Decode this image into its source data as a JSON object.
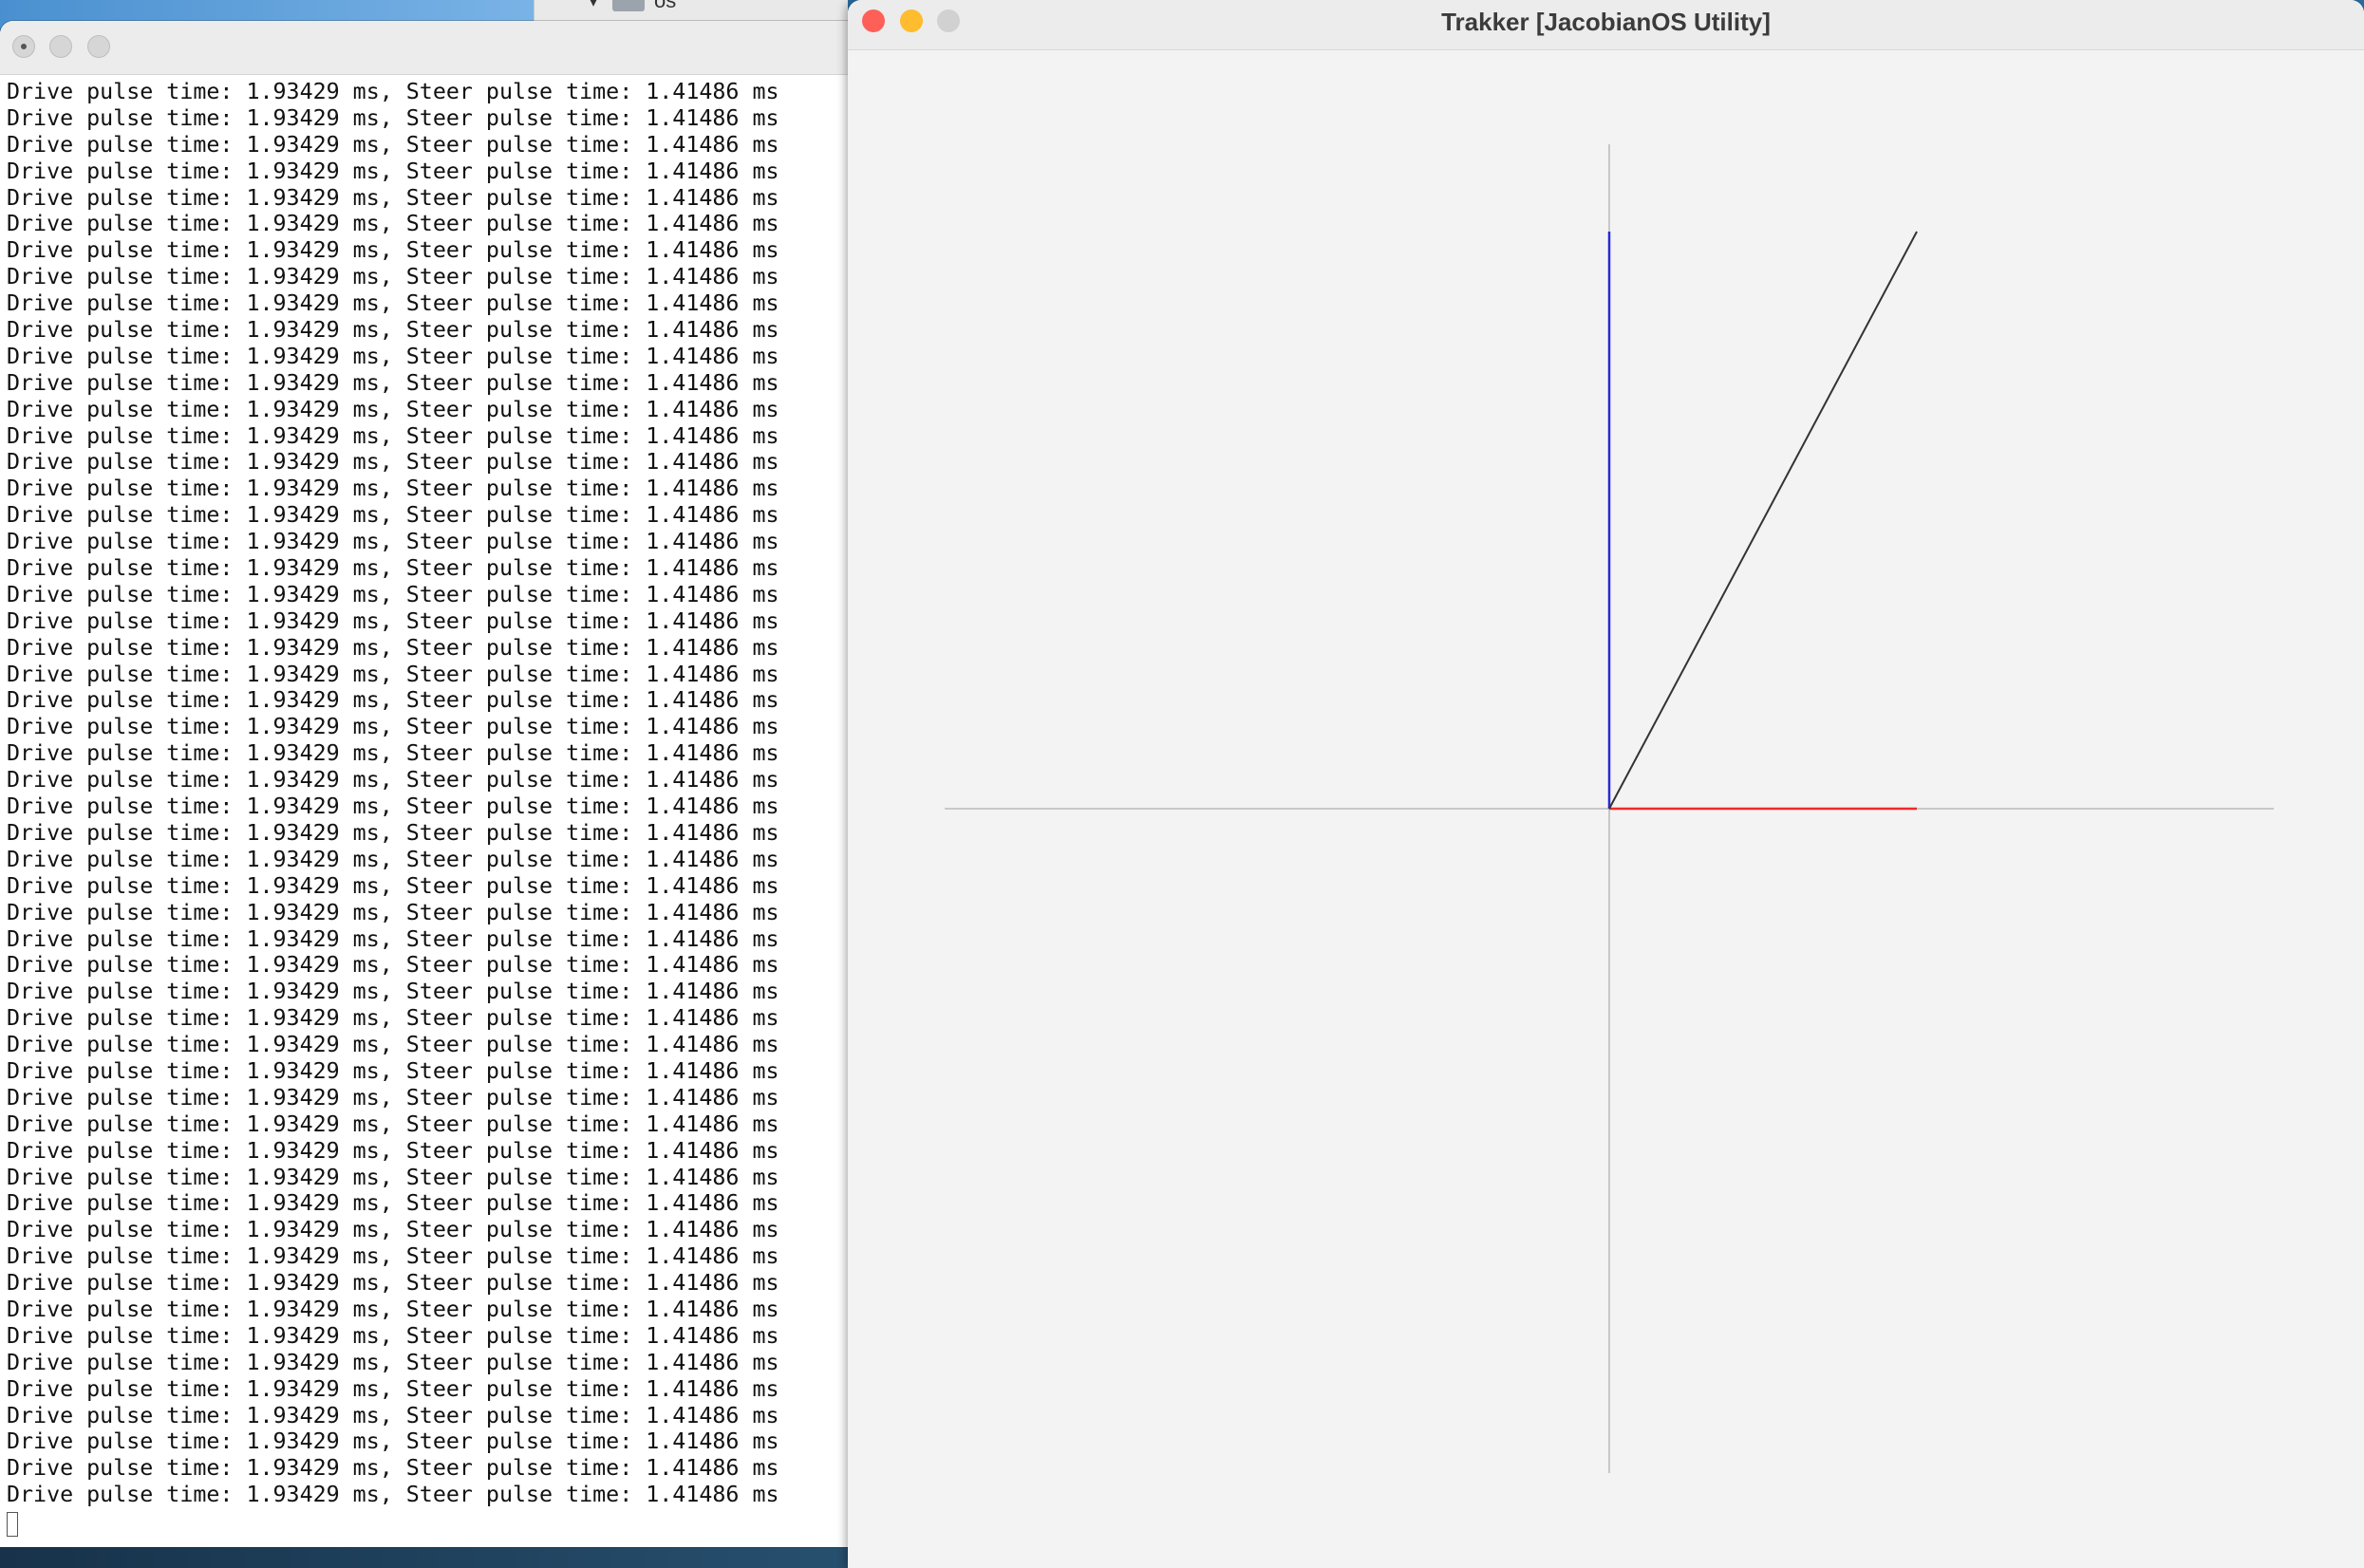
{
  "finder": {
    "folder_label": "os"
  },
  "terminal": {
    "line_text": "Drive pulse time: 1.93429 ms, Steer pulse time: 1.41486 ms",
    "line_count": 54
  },
  "trakker": {
    "title": "Trakker [JacobianOS Utility]",
    "colors": {
      "axes": "#c8c8c8",
      "vertical_vector": "#2a2ad6",
      "horizontal_vector": "#ee2a2a",
      "diagonal_vector": "#333333"
    }
  }
}
